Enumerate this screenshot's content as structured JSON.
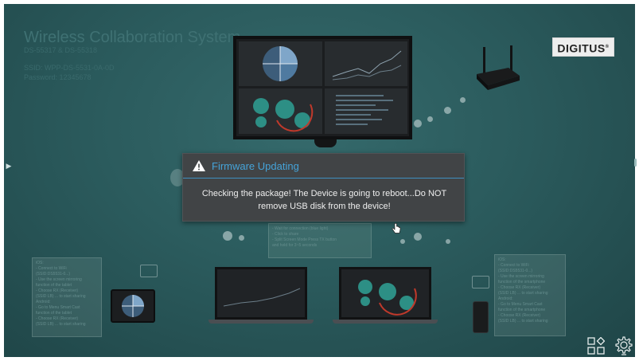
{
  "system": {
    "title": "Wireless Collaboration System",
    "model": "DS-55317 & DS-55318",
    "line1": "SSID: WPP-DS-5531-0A-0D",
    "line2": "Password: 12345678"
  },
  "brand": {
    "name": "DIGITUS",
    "mark": "®"
  },
  "dialog": {
    "title": "Firmware Updating",
    "message_line1": "Checking the package! The Device is going to reboot...Do NOT",
    "message_line2": "remove USB disk from the device!",
    "accent_color": "#45a3d8"
  },
  "instructions": {
    "left": [
      "iOS:",
      "- Connect to WiFi",
      "  (SSID:DS5531-0...)",
      "- Use the screen mirroring",
      "  function of the tablet",
      "- Choose RX (Receiver)",
      "  (SSID LB) ... to start sharing",
      "Android:",
      "- Go to Menu Smart Cast",
      "  function of the tablet",
      "- Choose RX (Receiver)",
      "  (SSID LB) ... to start sharing"
    ],
    "right": [
      "iOS:",
      "- Connect to WiFi",
      "  (SSID:DS5531-0...)",
      "- Use the screen mirroring",
      "  function of the smartphone",
      "- Choose RX (Receiver)",
      "  (SSID LB) ... to start sharing",
      "Android:",
      "- Go to Menu Smart Cast",
      "  function of the smartphone",
      "- Choose RX (Receiver)",
      "  (SSID LB) ... to start sharing"
    ],
    "center": [
      "- Wait for connection (blue light)",
      "- Click to share",
      "- Split Screen Mode Press TX button",
      "  and hold for 3~5 seconds"
    ]
  },
  "icons": {
    "warning": "warning-triangle-icon",
    "apps": "apps-grid-icon",
    "settings": "settings-gear-icon",
    "side": "chevron-right-icon"
  },
  "colors": {
    "background": "#2b5b5d",
    "dialog_bg": "#414446",
    "dialog_text": "#eeeeee"
  }
}
